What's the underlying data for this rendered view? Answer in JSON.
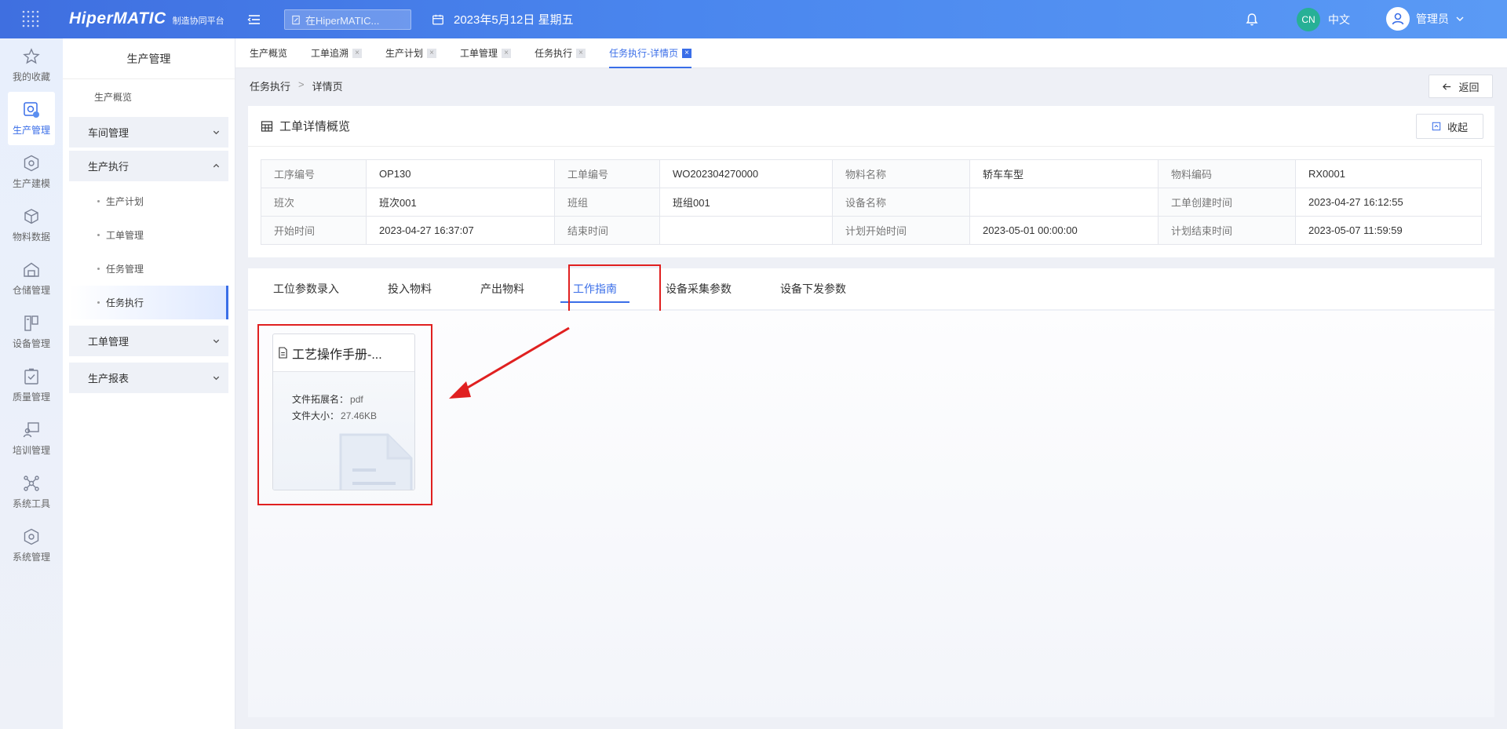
{
  "header": {
    "logo_text": "HiperMATIC",
    "logo_sub": "制造协同平台",
    "search_placeholder": "在HiperMATIC...",
    "date": "2023年5月12日 星期五",
    "lang_badge": "CN",
    "lang_label": "中文",
    "user_name": "管理员"
  },
  "rail": {
    "items": [
      {
        "label": "我的收藏",
        "icon": "star-icon"
      },
      {
        "label": "生产管理",
        "icon": "production-icon"
      },
      {
        "label": "生产建模",
        "icon": "cube-icon"
      },
      {
        "label": "物料数据",
        "icon": "box-icon"
      },
      {
        "label": "仓储管理",
        "icon": "warehouse-icon"
      },
      {
        "label": "设备管理",
        "icon": "device-icon"
      },
      {
        "label": "质量管理",
        "icon": "quality-icon"
      },
      {
        "label": "培训管理",
        "icon": "training-icon"
      },
      {
        "label": "系统工具",
        "icon": "tools-icon"
      },
      {
        "label": "系统管理",
        "icon": "settings-icon"
      }
    ]
  },
  "sidebar": {
    "title": "生产管理",
    "overview": "生产概览",
    "groups": {
      "workshop": "车间管理",
      "execution": "生产执行",
      "workorder": "工单管理",
      "report": "生产报表"
    },
    "sub_items": [
      "生产计划",
      "工单管理",
      "任务管理",
      "任务执行"
    ]
  },
  "tabs": [
    "生产概览",
    "工单追溯",
    "生产计划",
    "工单管理",
    "任务执行",
    "任务执行-详情页"
  ],
  "breadcrumb": {
    "parent": "任务执行",
    "sep": ">",
    "current": "详情页"
  },
  "back_label": "返回",
  "overview": {
    "title": "工单详情概览",
    "collapse_label": "收起",
    "rows": [
      [
        [
          "工序编号",
          "OP130"
        ],
        [
          "工单编号",
          "WO202304270000"
        ],
        [
          "物料名称",
          "轿车车型"
        ],
        [
          "物料编码",
          "RX0001"
        ]
      ],
      [
        [
          "班次",
          "班次001"
        ],
        [
          "班组",
          "班组001"
        ],
        [
          "设备名称",
          ""
        ],
        [
          "工单创建时间",
          "2023-04-27 16:12:55"
        ]
      ],
      [
        [
          "开始时间",
          "2023-04-27 16:37:07"
        ],
        [
          "结束时间",
          ""
        ],
        [
          "计划开始时间",
          "2023-05-01 00:00:00"
        ],
        [
          "计划结束时间",
          "2023-05-07 11:59:59"
        ]
      ]
    ]
  },
  "content_tabs": [
    "工位参数录入",
    "投入物料",
    "产出物料",
    "工作指南",
    "设备采集参数",
    "设备下发参数"
  ],
  "file_card": {
    "title": "工艺操作手册-...",
    "ext_label": "文件拓展名：",
    "ext_value": "pdf",
    "size_label": "文件大小：",
    "size_value": "27.46KB"
  },
  "colors": {
    "accent": "#3a6ee8",
    "highlight": "#e02020",
    "header_start": "#3f6fe0"
  }
}
